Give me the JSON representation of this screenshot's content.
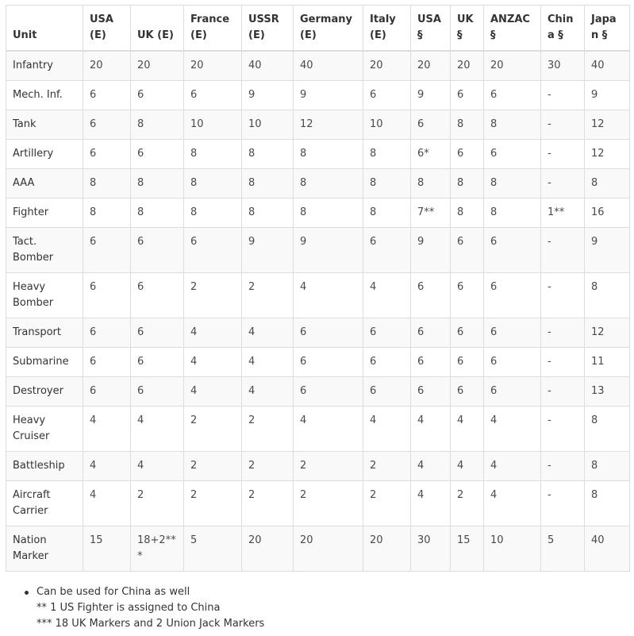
{
  "table": {
    "headers": [
      "Unit",
      "USA (E)",
      "UK (E)",
      "France (E)",
      "USSR (E)",
      "Germany (E)",
      "Italy (E)",
      "USA §",
      "UK §",
      "ANZAC§",
      "China §",
      "Japan §"
    ],
    "rows": [
      {
        "unit": "Infantry",
        "values": [
          "20",
          "20",
          "20",
          "40",
          "40",
          "20",
          "20",
          "20",
          "20",
          "30",
          "40"
        ]
      },
      {
        "unit": "Mech. Inf.",
        "values": [
          "6",
          "6",
          "6",
          "9",
          "9",
          "6",
          "9",
          "6",
          "6",
          "-",
          "9"
        ]
      },
      {
        "unit": "Tank",
        "values": [
          "6",
          "8",
          "10",
          "10",
          "12",
          "10",
          "6",
          "8",
          "8",
          "-",
          "12"
        ]
      },
      {
        "unit": "Artillery",
        "values": [
          "6",
          "6",
          "8",
          "8",
          "8",
          "8",
          "6*",
          "6",
          "6",
          "-",
          "12"
        ]
      },
      {
        "unit": "AAA",
        "values": [
          "8",
          "8",
          "8",
          "8",
          "8",
          "8",
          "8",
          "8",
          "8",
          "-",
          "8"
        ]
      },
      {
        "unit": "Fighter",
        "values": [
          "8",
          "8",
          "8",
          "8",
          "8",
          "8",
          "7**",
          "8",
          "8",
          "1**",
          "16"
        ]
      },
      {
        "unit": "Tact. Bomber",
        "values": [
          "6",
          "6",
          "6",
          "9",
          "9",
          "6",
          "9",
          "6",
          "6",
          "-",
          "9"
        ]
      },
      {
        "unit": "Heavy Bomber",
        "values": [
          "6",
          "6",
          "2",
          "2",
          "4",
          "4",
          "6",
          "6",
          "6",
          "-",
          "8"
        ]
      },
      {
        "unit": "Transport",
        "values": [
          "6",
          "6",
          "4",
          "4",
          "6",
          "6",
          "6",
          "6",
          "6",
          "-",
          "12"
        ]
      },
      {
        "unit": "Submarine",
        "values": [
          "6",
          "6",
          "4",
          "4",
          "6",
          "6",
          "6",
          "6",
          "6",
          "-",
          "11"
        ]
      },
      {
        "unit": "Destroyer",
        "values": [
          "6",
          "6",
          "4",
          "4",
          "6",
          "6",
          "6",
          "6",
          "6",
          "-",
          "13"
        ]
      },
      {
        "unit": "Heavy Cruiser",
        "values": [
          "4",
          "4",
          "2",
          "2",
          "4",
          "4",
          "4",
          "4",
          "4",
          "-",
          "8"
        ]
      },
      {
        "unit": "Battleship",
        "values": [
          "4",
          "4",
          "2",
          "2",
          "2",
          "2",
          "4",
          "4",
          "4",
          "-",
          "8"
        ]
      },
      {
        "unit": "Aircraft Carrier",
        "values": [
          "4",
          "2",
          "2",
          "2",
          "2",
          "2",
          "4",
          "2",
          "4",
          "-",
          "8"
        ]
      },
      {
        "unit": "Nation Marker",
        "values": [
          "15",
          "18+2***",
          "5",
          "20",
          "20",
          "20",
          "30",
          "15",
          "10",
          "5",
          "40"
        ]
      }
    ]
  },
  "notes": [
    "Can be used for China as well",
    "** 1 US Fighter is assigned to China",
    "*** 18 UK Markers and 2 Union Jack Markers"
  ]
}
